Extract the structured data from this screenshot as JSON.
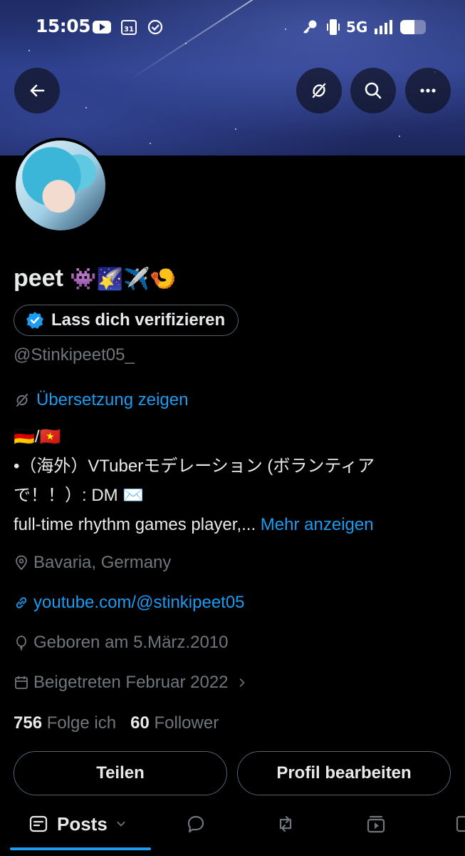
{
  "status_bar": {
    "time": "15:05",
    "calendar_day": "31",
    "network": "5G",
    "battery_level": 0.55
  },
  "profile": {
    "display_name": "peet",
    "name_emojis": "👾🌠✈️🍤",
    "verify_label": "Lass dich verifizieren",
    "handle": "@Stinkipeet05_",
    "translate_label": "Übersetzung zeigen",
    "bio": {
      "line1": "🇩🇪/🇻🇳",
      "line2": "•（海外）VTuberモデレーション (ボランティア",
      "line3": "で！！）: DM ✉️",
      "line4": "full-time rhythm games player,...",
      "more": "Mehr anzeigen"
    },
    "location": "Bavaria, Germany",
    "website": "youtube.com/@stinkipeet05",
    "birthday": "Geboren am 5.März.2010",
    "joined": "Beigetreten Februar 2022",
    "following_count": "756",
    "following_label": "Folge ich",
    "followers_count": "60",
    "followers_label": "Follower"
  },
  "actions": {
    "share": "Teilen",
    "edit": "Profil bearbeiten"
  },
  "tabs": {
    "posts": "Posts"
  },
  "colors": {
    "accent": "#1d9bf0",
    "muted": "#71767b",
    "text": "#e7e9ea",
    "background": "#000000"
  }
}
